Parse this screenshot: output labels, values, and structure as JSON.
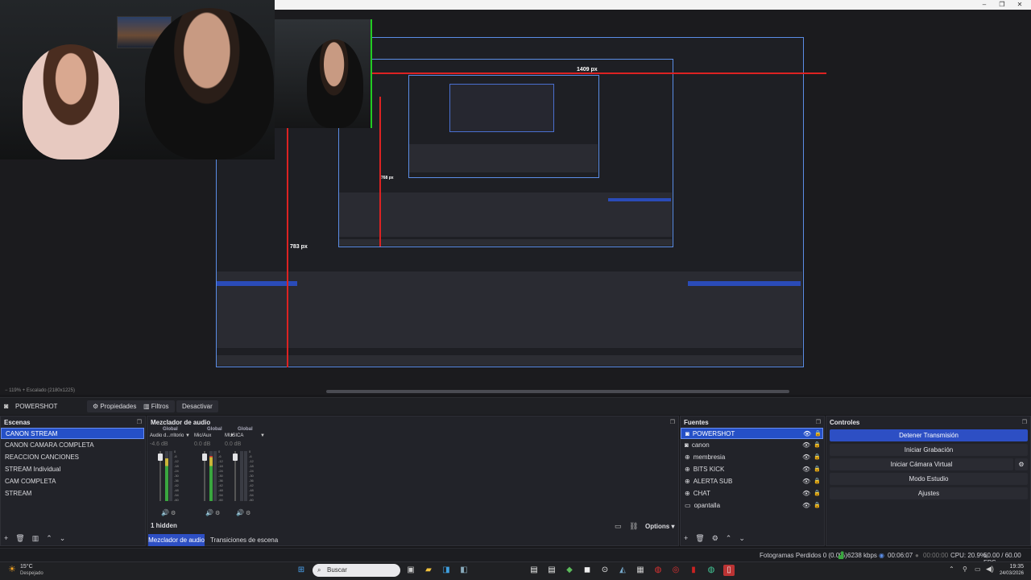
{
  "titlebar": {
    "minimize": "–",
    "maximize": "❐",
    "close": "✕"
  },
  "preview": {
    "measure_top": "1409 px",
    "measure_left": "783 px",
    "measure_small": "768 px",
    "zoom_text": "119%",
    "scaled_text": "Escalado (2180x1225)"
  },
  "context": {
    "source_name": "POWERSHOT",
    "properties": "Propiedades",
    "filters": "Filtros",
    "deactivate": "Desactivar"
  },
  "scenes": {
    "title": "Escenas",
    "items": [
      {
        "label": "CANON STREAM"
      },
      {
        "label": "CANON CAMARA COMPLETA"
      },
      {
        "label": "REACCION CANCIONES"
      },
      {
        "label": "STREAM Individual"
      },
      {
        "label": "CAM COMPLETA"
      },
      {
        "label": "STREAM"
      }
    ]
  },
  "mixer": {
    "title": "Mezclador de audio",
    "channels": [
      {
        "scope": "Global",
        "name": "Audio d...rritorio",
        "db": "-4.6 dB",
        "level": 0.85
      },
      {
        "scope": "Global",
        "name": "Mic/Aux",
        "db": "0.0 dB",
        "level": 0.9
      },
      {
        "scope": "Global",
        "name": "MUSICA",
        "db": "0.0 dB",
        "level": 0.0
      }
    ],
    "ticks": [
      "0",
      "-6",
      "-12",
      "-18",
      "-24",
      "-30",
      "-36",
      "-42",
      "-48",
      "-54",
      "-60"
    ],
    "hidden": "1 hidden",
    "options": "Options",
    "tab_mixer": "Mezclador de audio",
    "tab_transitions": "Transiciones de escena"
  },
  "sources": {
    "title": "Fuentes",
    "items": [
      {
        "label": "POWERSHOT",
        "icon": "camera-icon"
      },
      {
        "label": "canon",
        "icon": "camera-icon"
      },
      {
        "label": "membresia",
        "icon": "globe-icon"
      },
      {
        "label": "BITS KICK",
        "icon": "globe-icon"
      },
      {
        "label": "ALERTA SUB",
        "icon": "globe-icon"
      },
      {
        "label": "CHAT",
        "icon": "globe-icon"
      },
      {
        "label": "opantalla",
        "icon": "display-icon"
      }
    ]
  },
  "controls": {
    "title": "Controles",
    "stop_stream": "Detener Transmisión",
    "start_record": "Iniciar Grabación",
    "virtual_cam": "Iniciar Cámara Virtual",
    "studio_mode": "Modo Estudio",
    "settings": "Ajustes"
  },
  "status": {
    "dropped": "Fotogramas Perdidos 0 (0.0%)",
    "bitrate": "6238 kbps",
    "stream_time": "00:06:07",
    "rec_time": "00:00:00",
    "cpu": "CPU: 20.9%,",
    "fps": "60.00 / 60.00 FPS"
  },
  "taskbar": {
    "weather_temp": "15°C",
    "weather_desc": "Despejado",
    "search_placeholder": "Buscar",
    "time": "19:35",
    "date": "24/03/2026"
  },
  "colors": {
    "accent": "#2d4fc4",
    "selection": "#2550c7",
    "panel": "#222329",
    "measure_red": "#dd2222",
    "preview_border": "#5b8de6"
  }
}
